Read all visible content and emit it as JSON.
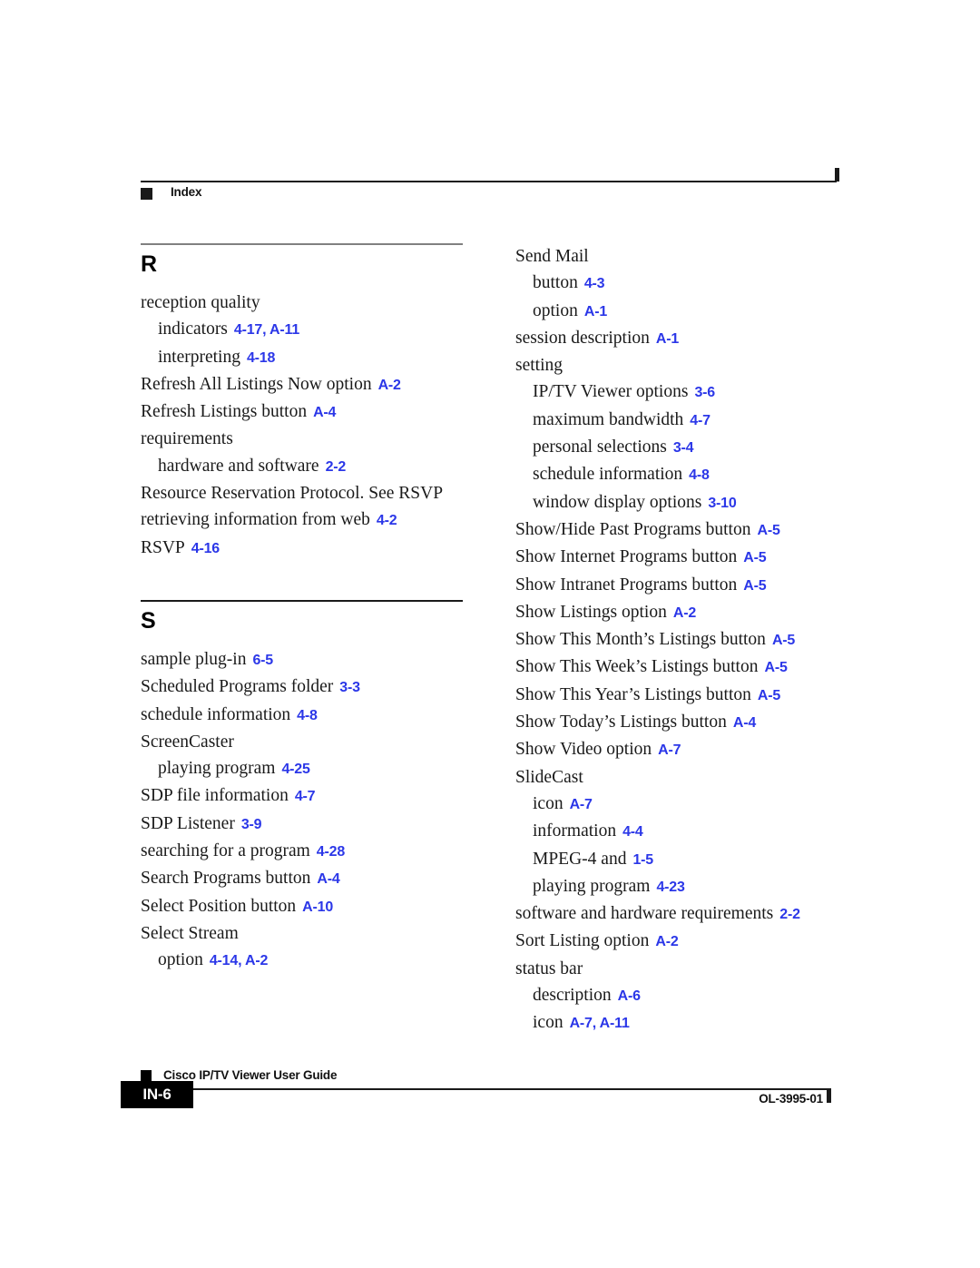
{
  "header": {
    "label": "Index",
    "marker_icon": "black-square-icon"
  },
  "colors": {
    "reference_blue": "#2b37e8",
    "rule_gray": "#808080",
    "text_black": "#1a1a1a"
  },
  "columns": {
    "left": {
      "sections": [
        {
          "letter": "R",
          "rule_style": "gray",
          "entries": [
            {
              "level": 1,
              "term": "reception quality",
              "ref": ""
            },
            {
              "level": 2,
              "term": "indicators",
              "ref": "4-17, A-11"
            },
            {
              "level": 2,
              "term": "interpreting",
              "ref": "4-18"
            },
            {
              "level": 1,
              "term": "Refresh All Listings Now option",
              "ref": "A-2"
            },
            {
              "level": 1,
              "term": "Refresh Listings button",
              "ref": "A-4"
            },
            {
              "level": 1,
              "term": "requirements",
              "ref": ""
            },
            {
              "level": 2,
              "term": "hardware and software",
              "ref": "2-2"
            },
            {
              "level": 1,
              "term": "Resource Reservation Protocol. See RSVP",
              "ref": ""
            },
            {
              "level": 1,
              "term": "retrieving information from web",
              "ref": "4-2"
            },
            {
              "level": 1,
              "term": "RSVP",
              "ref": "4-16"
            }
          ]
        },
        {
          "letter": "S",
          "rule_style": "dark",
          "entries": [
            {
              "level": 1,
              "term": "sample plug-in",
              "ref": "6-5"
            },
            {
              "level": 1,
              "term": "Scheduled Programs folder",
              "ref": "3-3"
            },
            {
              "level": 1,
              "term": "schedule information",
              "ref": "4-8"
            },
            {
              "level": 1,
              "term": "ScreenCaster",
              "ref": ""
            },
            {
              "level": 2,
              "term": "playing program",
              "ref": "4-25"
            },
            {
              "level": 1,
              "term": "SDP file information",
              "ref": "4-7"
            },
            {
              "level": 1,
              "term": "SDP Listener",
              "ref": "3-9"
            },
            {
              "level": 1,
              "term": "searching for a program",
              "ref": "4-28"
            },
            {
              "level": 1,
              "term": "Search Programs button",
              "ref": "A-4"
            },
            {
              "level": 1,
              "term": "Select Position button",
              "ref": "A-10"
            },
            {
              "level": 1,
              "term": "Select Stream",
              "ref": ""
            },
            {
              "level": 2,
              "term": "option",
              "ref": "4-14, A-2"
            }
          ]
        }
      ]
    },
    "right": {
      "sections": [
        {
          "letter": "",
          "rule_style": "none",
          "entries": [
            {
              "level": 1,
              "term": "Send Mail",
              "ref": ""
            },
            {
              "level": 2,
              "term": "button",
              "ref": "4-3"
            },
            {
              "level": 2,
              "term": "option",
              "ref": "A-1"
            },
            {
              "level": 1,
              "term": "session description",
              "ref": "A-1"
            },
            {
              "level": 1,
              "term": "setting",
              "ref": ""
            },
            {
              "level": 2,
              "term": "IP/TV Viewer options",
              "ref": "3-6"
            },
            {
              "level": 2,
              "term": "maximum bandwidth",
              "ref": "4-7"
            },
            {
              "level": 2,
              "term": "personal selections",
              "ref": "3-4"
            },
            {
              "level": 2,
              "term": "schedule information",
              "ref": "4-8"
            },
            {
              "level": 2,
              "term": "window display options",
              "ref": "3-10"
            },
            {
              "level": 1,
              "term": "Show/Hide Past Programs button",
              "ref": "A-5"
            },
            {
              "level": 1,
              "term": "Show Internet Programs button",
              "ref": "A-5"
            },
            {
              "level": 1,
              "term": "Show Intranet Programs button",
              "ref": "A-5"
            },
            {
              "level": 1,
              "term": "Show Listings option",
              "ref": "A-2"
            },
            {
              "level": 1,
              "term": "Show This Month’s Listings button",
              "ref": "A-5"
            },
            {
              "level": 1,
              "term": "Show This Week’s Listings button",
              "ref": "A-5"
            },
            {
              "level": 1,
              "term": "Show This Year’s Listings button",
              "ref": "A-5"
            },
            {
              "level": 1,
              "term": "Show Today’s Listings button",
              "ref": "A-4"
            },
            {
              "level": 1,
              "term": "Show Video option",
              "ref": "A-7"
            },
            {
              "level": 1,
              "term": "SlideCast",
              "ref": ""
            },
            {
              "level": 2,
              "term": "icon",
              "ref": "A-7"
            },
            {
              "level": 2,
              "term": "information",
              "ref": "4-4"
            },
            {
              "level": 2,
              "term": "MPEG-4 and",
              "ref": "1-5"
            },
            {
              "level": 2,
              "term": "playing program",
              "ref": "4-23"
            },
            {
              "level": 1,
              "term": "software and hardware requirements",
              "ref": "2-2"
            },
            {
              "level": 1,
              "term": "Sort Listing option",
              "ref": "A-2"
            },
            {
              "level": 1,
              "term": "status bar",
              "ref": ""
            },
            {
              "level": 2,
              "term": "description",
              "ref": "A-6"
            },
            {
              "level": 2,
              "term": "icon",
              "ref": "A-7, A-11"
            }
          ]
        }
      ]
    }
  },
  "footer": {
    "marker_icon": "black-square-icon",
    "guide_title": "Cisco IP/TV Viewer User Guide",
    "page_number": "IN-6",
    "doc_id": "OL-3995-01"
  }
}
